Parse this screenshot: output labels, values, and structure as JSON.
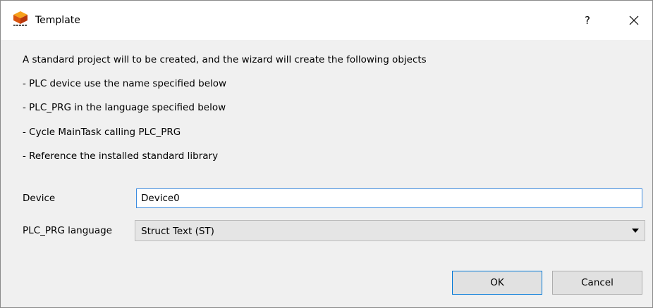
{
  "window": {
    "title": "Template",
    "help_label": "?",
    "app_icon": "codesys-cube-icon",
    "close_icon": "close-icon"
  },
  "description": {
    "intro": "A standard project will to be created, and the wizard will create the following objects",
    "items": [
      "- PLC device use the name specified below",
      "- PLC_PRG in the language specified below",
      "- Cycle MainTask calling PLC_PRG",
      "- Reference the installed standard library"
    ]
  },
  "form": {
    "device_label": "Device",
    "device_value": "Device0",
    "language_label": "PLC_PRG language",
    "language_value": "Struct Text (ST)"
  },
  "buttons": {
    "ok_label": "OK",
    "cancel_label": "Cancel"
  },
  "colors": {
    "accent": "#0078d7",
    "input_focus_border": "#3c8ce0",
    "background": "#f0f0f0",
    "titlebar": "#ffffff"
  }
}
